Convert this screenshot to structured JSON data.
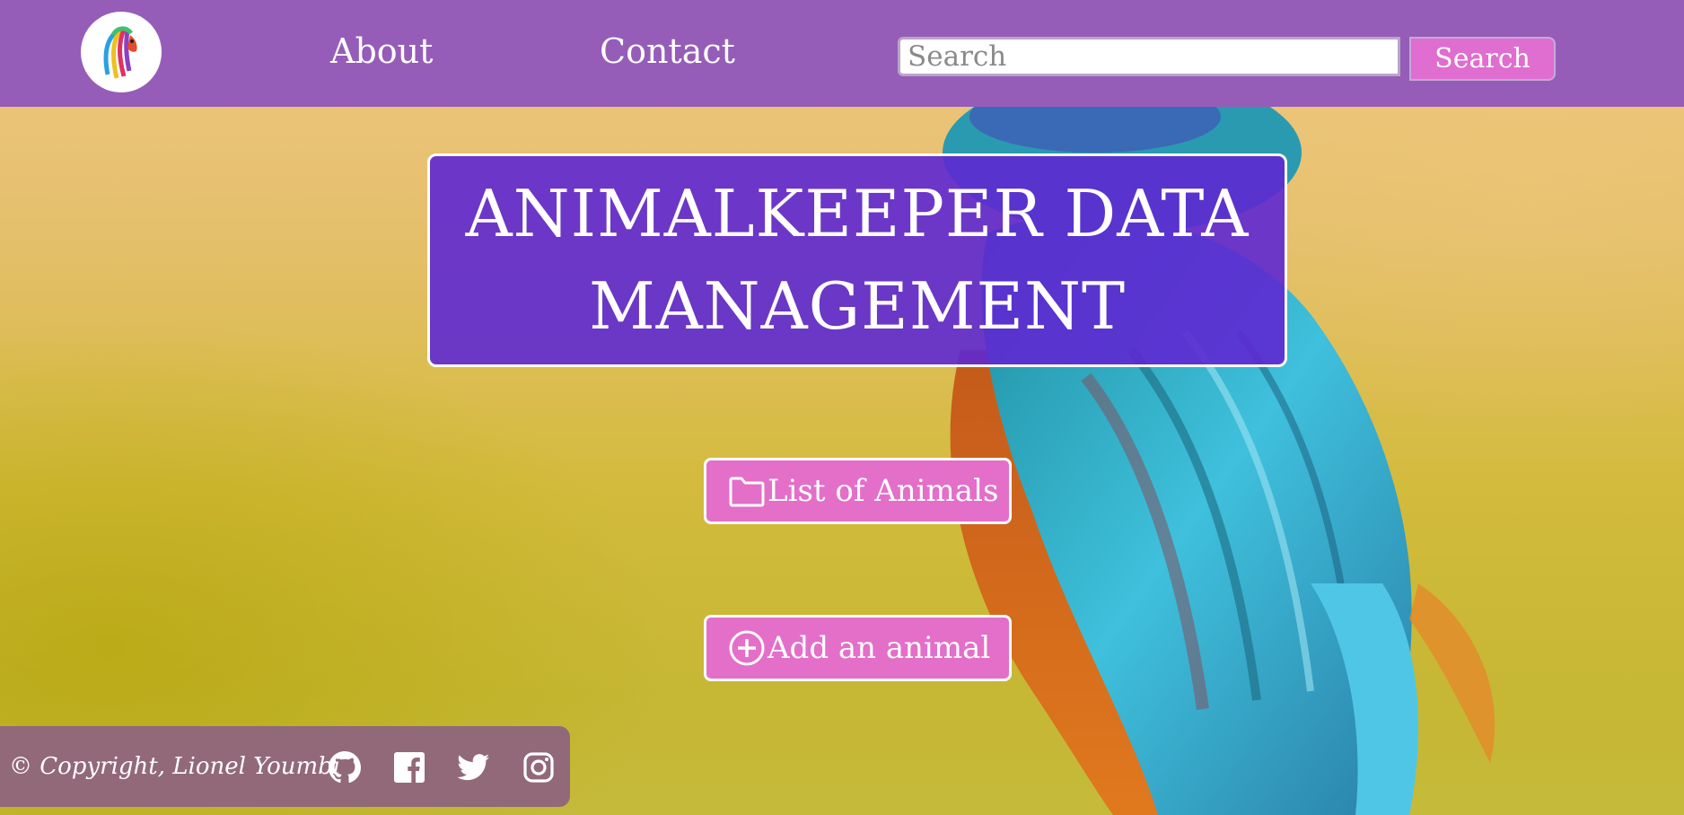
{
  "header": {
    "logo_icon": "parrot-logo",
    "nav": {
      "about": "About",
      "contact": "Contact"
    },
    "search": {
      "placeholder": "Search",
      "value": "",
      "button_label": "Search"
    }
  },
  "hero": {
    "title": "ANIMALKEEPER DATA MANAGEMENT"
  },
  "actions": {
    "list_animals": {
      "label": "List of Animals",
      "icon": "folder-icon"
    },
    "add_animal": {
      "label": "Add an animal",
      "icon": "plus-circle-icon"
    }
  },
  "footer": {
    "copyright": "© Copyright, Lionel Youmbi",
    "social": [
      "github-icon",
      "facebook-icon",
      "twitter-icon",
      "instagram-icon"
    ]
  },
  "colors": {
    "header_bg": "#955db8",
    "title_bg": "#5e28d2",
    "button_pink": "#e36fc9",
    "footer_bg": "#926979"
  }
}
